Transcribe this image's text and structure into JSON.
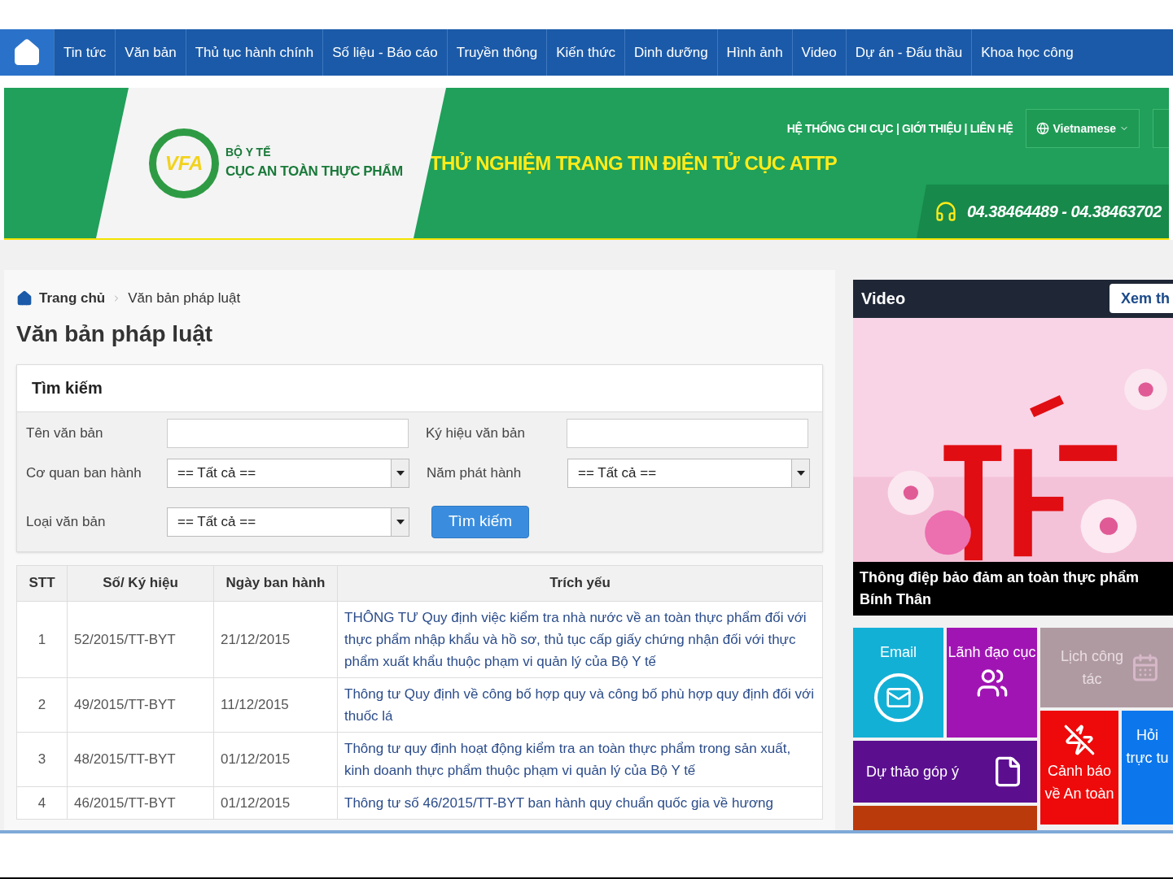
{
  "nav": {
    "items": [
      "Tin tức",
      "Văn bản",
      "Thủ tục hành chính",
      "Số liệu - Báo cáo",
      "Truyền thông",
      "Kiến thức",
      "Dinh dưỡng",
      "Hình ảnh",
      "Video",
      "Dự án - Đấu thầu",
      "Khoa học công"
    ]
  },
  "header": {
    "logo_mark": "VFA",
    "logo_top": "BỘ Y TẾ",
    "logo_name": "CỤC AN TOÀN THỰC PHẨM",
    "top_links": "HỆ THỐNG CHI CỤC | GIỚI THIỆU | LIÊN HỆ",
    "language": "Vietnamese",
    "title": "THỬ NGHIỆM TRANG TIN ĐIỆN TỬ CỤC ATTP",
    "phone": "04.38464489 - 04.38463702"
  },
  "breadcrumb": [
    "Trang chủ",
    "Văn bản pháp luật"
  ],
  "page_title": "Văn bản pháp luật",
  "search": {
    "title": "Tìm kiếm",
    "fields": [
      {
        "label": "Tên văn bản",
        "kind": "text"
      },
      {
        "label": "Ký hiệu văn bản",
        "kind": "text"
      },
      {
        "label": "Cơ quan ban hành",
        "kind": "select",
        "value": "== Tất cả =="
      },
      {
        "label": "Năm phát hành",
        "kind": "select",
        "value": "== Tất cả =="
      },
      {
        "label": "Loại văn bản",
        "kind": "select",
        "value": "== Tất cả =="
      }
    ],
    "button": "Tìm kiếm"
  },
  "table": {
    "columns": [
      "STT",
      "Số/ Ký hiệu",
      "Ngày ban hành",
      "Trích yếu"
    ],
    "rows": [
      [
        "1",
        "52/2015/TT-BYT",
        "21/12/2015",
        "THÔNG TƯ Quy định việc kiểm tra nhà nước về an toàn thực phẩm đối với thực phẩm nhập khẩu và hồ sơ, thủ tục cấp giấy chứng nhận đối với thực phẩm xuất khẩu thuộc phạm vi quản lý của Bộ Y tế"
      ],
      [
        "2",
        "49/2015/TT-BYT",
        "11/12/2015",
        "Thông tư Quy định về công bố hợp quy và công bố phù hợp quy định đối với thuốc lá"
      ],
      [
        "3",
        "48/2015/TT-BYT",
        "01/12/2015",
        "Thông tư quy định hoạt động kiểm tra an toàn thực phẩm trong sản xuất, kinh doanh thực phẩm thuộc phạm vi quản lý của Bộ Y tế"
      ],
      [
        "4",
        "46/2015/TT-BYT",
        "01/12/2015",
        "Thông tư số 46/2015/TT-BYT ban hành quy chuẩn quốc gia về hương"
      ]
    ]
  },
  "video": {
    "title": "Video",
    "more": "Xem th",
    "caption": "Thông điệp bảo đảm an toàn thực phẩm Bính Thân"
  },
  "tiles": [
    {
      "kind": "email",
      "label": "Email",
      "color": "#13b0d6"
    },
    {
      "kind": "leaders",
      "label": "Lãnh đạo cục",
      "color": "#a114b4"
    },
    {
      "kind": "draft",
      "label": "Dự thảo góp ý",
      "color": "#5b0f8f"
    },
    {
      "kind": "blank",
      "color": "#bb3a0c"
    },
    {
      "kind": "calendar",
      "label": "Lịch công tác",
      "color": "#b09aa2"
    },
    {
      "kind": "warning",
      "label": "Cảnh báo về An toàn",
      "color": "#ee0a0a"
    },
    {
      "kind": "question",
      "label": "Hỏi trực tu",
      "color": "#0c77ec"
    }
  ]
}
